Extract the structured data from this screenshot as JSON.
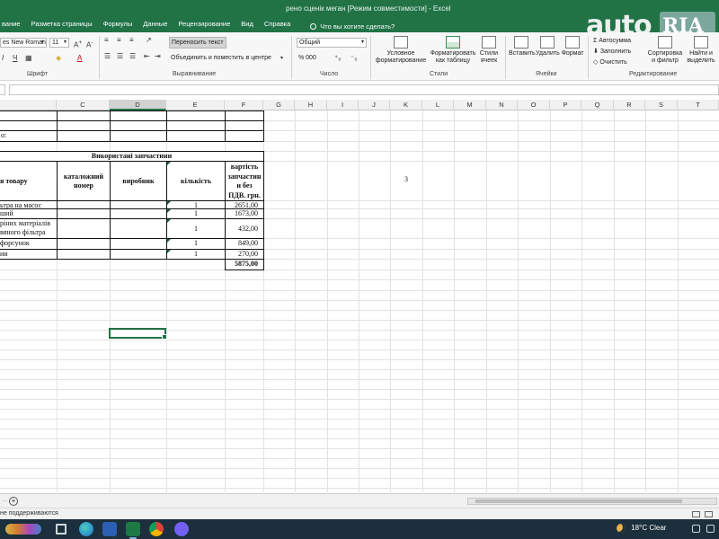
{
  "app": {
    "title": "рено сценік меган  [Режим совместимости]  -  Excel",
    "accent": "#217346"
  },
  "menu": {
    "items": [
      "вание",
      "Разметка страницы",
      "Формулы",
      "Данные",
      "Рецензирование",
      "Вид",
      "Справка"
    ],
    "tellme": "Что вы хотите сделать?"
  },
  "watermark": {
    "left": "auto",
    "right": "RIA",
    "sub": ".com"
  },
  "ribbon": {
    "font_name": "es New Roman",
    "font_size": "11",
    "number_format": "Общий",
    "wrap_text": "Переносить текст",
    "merge_center": "Объединить и поместить в центре",
    "autosum": "Автосумма",
    "fill": "Заполнить",
    "clear": "Очистить",
    "conditional_1": "Условное",
    "conditional_2": "форматирование",
    "format_table_1": "Форматировать",
    "format_table_2": "как таблицу",
    "cell_styles_1": "Стили",
    "cell_styles_2": "ячеек",
    "insert": "Вставить",
    "delete": "Удалить",
    "format": "Формат",
    "sort_1": "Сортировка",
    "sort_2": "и фильтр",
    "find_1": "Найти и",
    "find_2": "выделить",
    "number_buttons": "% 000",
    "groups": {
      "font": "Шрифт",
      "alignment": "Выравнивание",
      "number": "Число",
      "styles": "Стили",
      "cells": "Ячейки",
      "editing": "Редактирование"
    }
  },
  "columns": [
    "C",
    "D",
    "E",
    "F",
    "G",
    "H",
    "I",
    "J",
    "K",
    "L",
    "M",
    "N",
    "O",
    "P",
    "Q",
    "R",
    "S",
    "T"
  ],
  "sheet": {
    "row_label_fragment": "о:",
    "table_title": "Використані запчастини",
    "headers": {
      "name": "я товару",
      "catalog_1": "каталожний",
      "catalog_2": "номер",
      "maker": "виробник",
      "qty": "кількість",
      "price_1": "вартість",
      "price_2": "запчастин",
      "price_3": "и без",
      "price_4": "ПДВ. грн."
    },
    "rows": [
      {
        "name": "ьтра на масос",
        "qty": "1",
        "price": "2651,00"
      },
      {
        "name": "ший",
        "qty": "1",
        "price": "1673,00"
      },
      {
        "name": "ріних матеріалів",
        "name2": "вяного фільтра",
        "qty": "1",
        "price": "432,00"
      },
      {
        "name": "форсунок",
        "qty": "1",
        "price": "849,00"
      },
      {
        "name": "ии",
        "qty": "1",
        "price": "270,00"
      }
    ],
    "total": "5875,00",
    "k_value": "3"
  },
  "statusbar": {
    "text": "не поддерживаются"
  },
  "taskbar": {
    "temp": "18°C",
    "weather": "Clear"
  }
}
